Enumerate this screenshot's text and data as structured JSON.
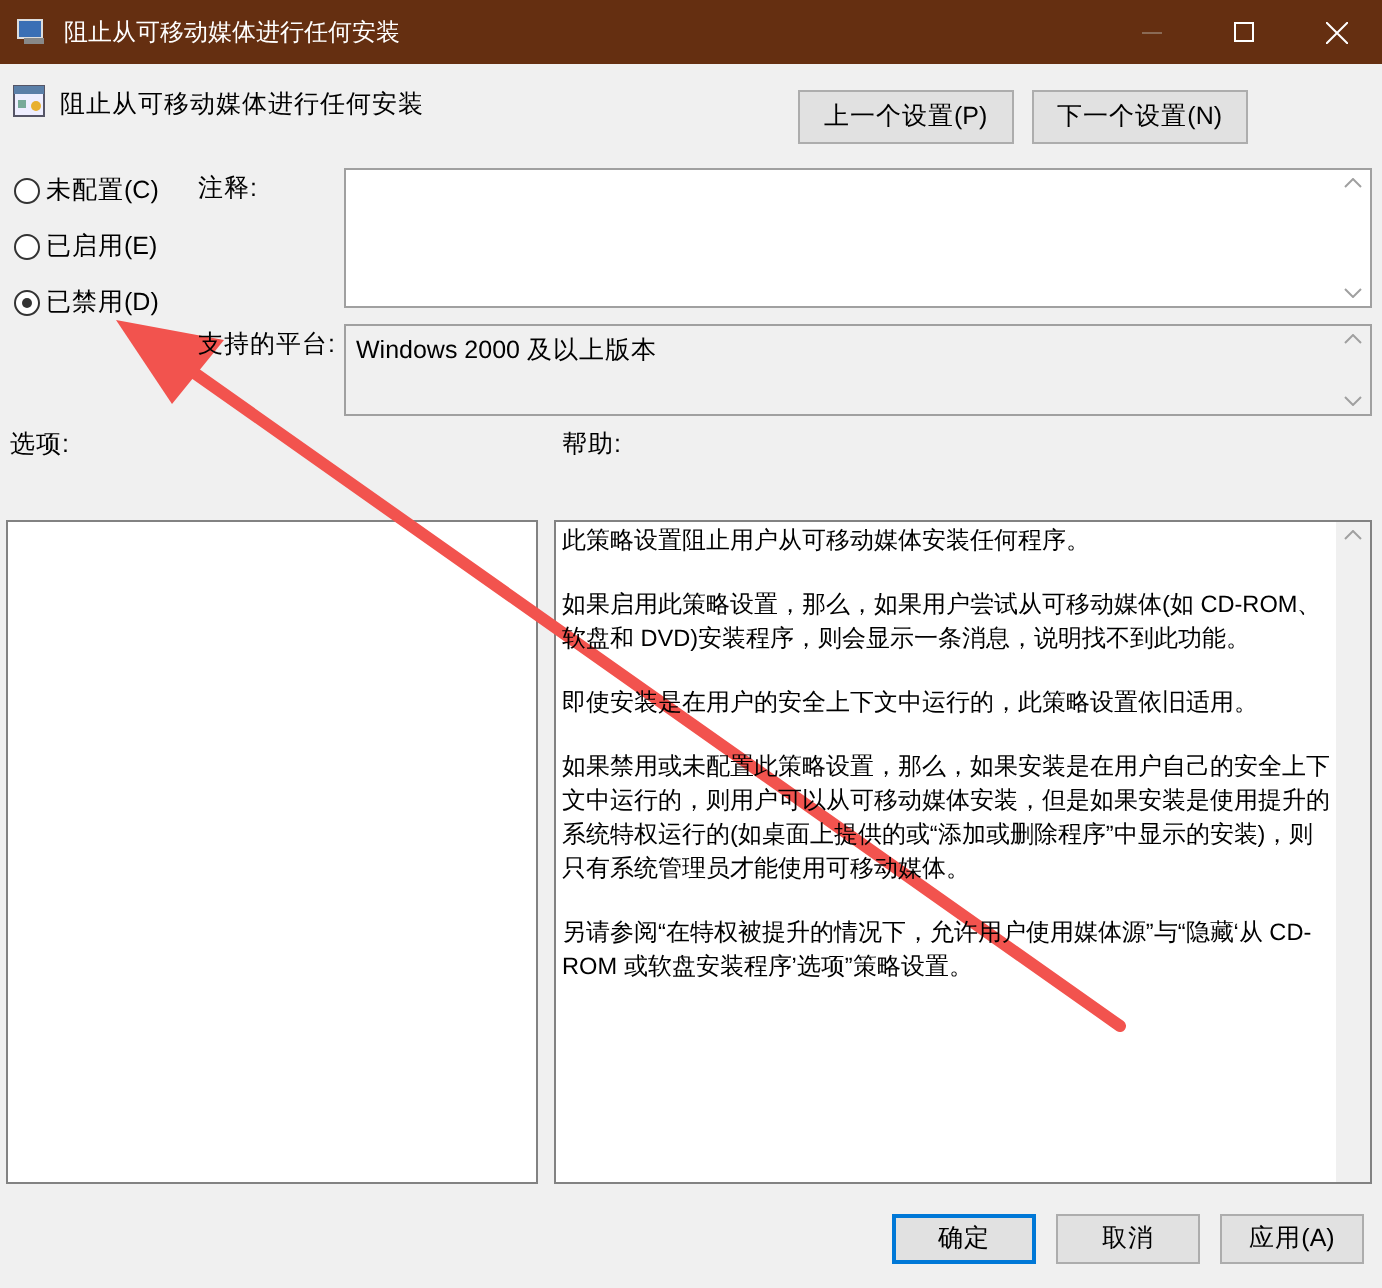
{
  "window": {
    "title": "阻止从可移动媒体进行任何安装"
  },
  "policy_title": "阻止从可移动媒体进行任何安装",
  "nav_buttons": [
    "上一个设置(P)",
    "下一个设置(N)"
  ],
  "options_radio": [
    {
      "label": "未配置(C)",
      "selected": false
    },
    {
      "label": "已启用(E)",
      "selected": false
    },
    {
      "label": "已禁用(D)",
      "selected": true
    }
  ],
  "comment": {
    "label": "注释:"
  },
  "platform": {
    "label": "支持的平台:",
    "value": "Windows 2000 及以上版本"
  },
  "options_label": "选项:",
  "help_label": "帮助:",
  "help_paragraphs": [
    "此策略设置阻止用户从可移动媒体安装任何程序。",
    "如果启用此策略设置，那么，如果用户尝试从可移动媒体(如 CD-ROM、软盘和 DVD)安装程序，则会显示一条消息，说明找不到此功能。",
    "即使安装是在用户的安全上下文中运行的，此策略设置依旧适用。",
    "如果禁用或未配置此策略设置，那么，如果安装是在用户自己的安全上下文中运行的，则用户可以从可移动媒体安装，但是如果安装是使用提升的系统特权运行的(如桌面上提供的或“添加或删除程序”中显示的安装)，则只有系统管理员才能使用可移动媒体。",
    "另请参阅“在特权被提升的情况下，允许用户使用媒体源”与“隐藏‘从 CD-ROM 或软盘安装程序’选项”策略设置。"
  ],
  "footer_buttons": [
    {
      "label": "确定",
      "selected": true
    },
    {
      "label": "取消",
      "selected": false
    },
    {
      "label": "应用(A)",
      "selected": false
    }
  ],
  "annotation": {
    "kind": "arrow"
  }
}
